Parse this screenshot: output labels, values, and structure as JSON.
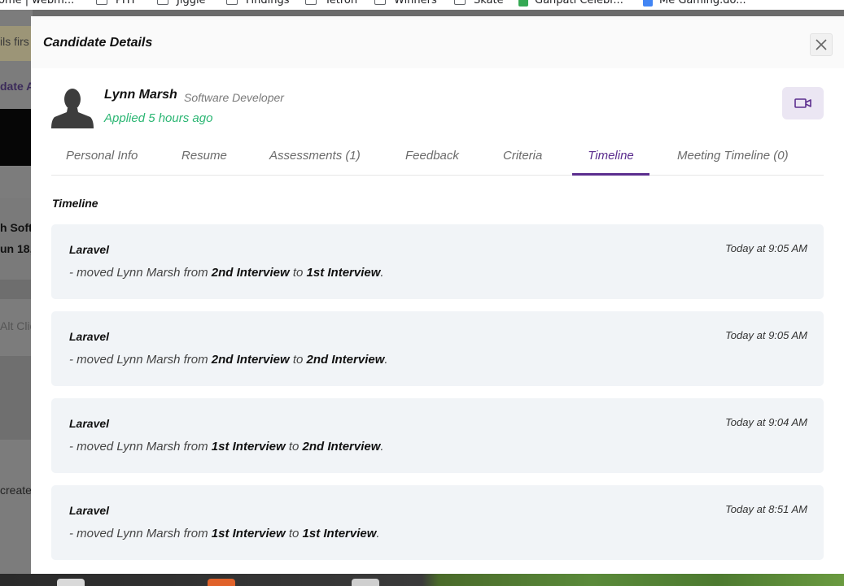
{
  "bookmarks": [
    {
      "label": "ome | webm...",
      "icon": "none"
    },
    {
      "label": "PHT",
      "icon": "folder-icon"
    },
    {
      "label": "Jiggle",
      "icon": "folder-icon"
    },
    {
      "label": "Findings",
      "icon": "folder-icon"
    },
    {
      "label": "Tetron",
      "icon": "folder-icon"
    },
    {
      "label": "Winners",
      "icon": "folder-icon"
    },
    {
      "label": "Skate",
      "icon": "folder-icon"
    },
    {
      "label": "Ganpati Celebr...",
      "icon": "sheets-icon"
    },
    {
      "label": "Me Gaming.do...",
      "icon": "docs-icon"
    }
  ],
  "background": {
    "t1": "ils firs",
    "t2": "date A",
    "t3": "h Soft",
    "t4": "un 18,",
    "t5": "Alt Clic",
    "t6": "create"
  },
  "modal": {
    "title": "Candidate Details",
    "candidate": {
      "name": "Lynn Marsh",
      "role": "Software Developer",
      "applied": "Applied 5 hours ago"
    },
    "tabs": [
      {
        "label": "Personal Info",
        "active": false
      },
      {
        "label": "Resume",
        "active": false
      },
      {
        "label": "Assessments (1)",
        "active": false
      },
      {
        "label": "Feedback",
        "active": false
      },
      {
        "label": "Criteria",
        "active": false
      },
      {
        "label": "Timeline",
        "active": true
      },
      {
        "label": "Meeting Timeline (0)",
        "active": false
      }
    ],
    "section_title": "Timeline",
    "entries": [
      {
        "user": "Laravel",
        "time": "Today at 9:05 AM",
        "prefix": "- moved Lynn Marsh from ",
        "from": "2nd Interview",
        "mid": " to ",
        "to": "1st Interview",
        "suffix": "."
      },
      {
        "user": "Laravel",
        "time": "Today at 9:05 AM",
        "prefix": "- moved Lynn Marsh from ",
        "from": "2nd Interview",
        "mid": " to ",
        "to": "2nd Interview",
        "suffix": "."
      },
      {
        "user": "Laravel",
        "time": "Today at 9:04 AM",
        "prefix": "- moved Lynn Marsh from ",
        "from": "1st Interview",
        "mid": " to ",
        "to": "2nd Interview",
        "suffix": "."
      },
      {
        "user": "Laravel",
        "time": "Today at 8:51 AM",
        "prefix": "- moved Lynn Marsh from ",
        "from": "1st Interview",
        "mid": " to ",
        "to": "1st Interview",
        "suffix": "."
      }
    ]
  },
  "colors": {
    "accent": "#5b2d8e",
    "applied_green": "#2bb673",
    "card_bg": "#f1f4f7"
  }
}
